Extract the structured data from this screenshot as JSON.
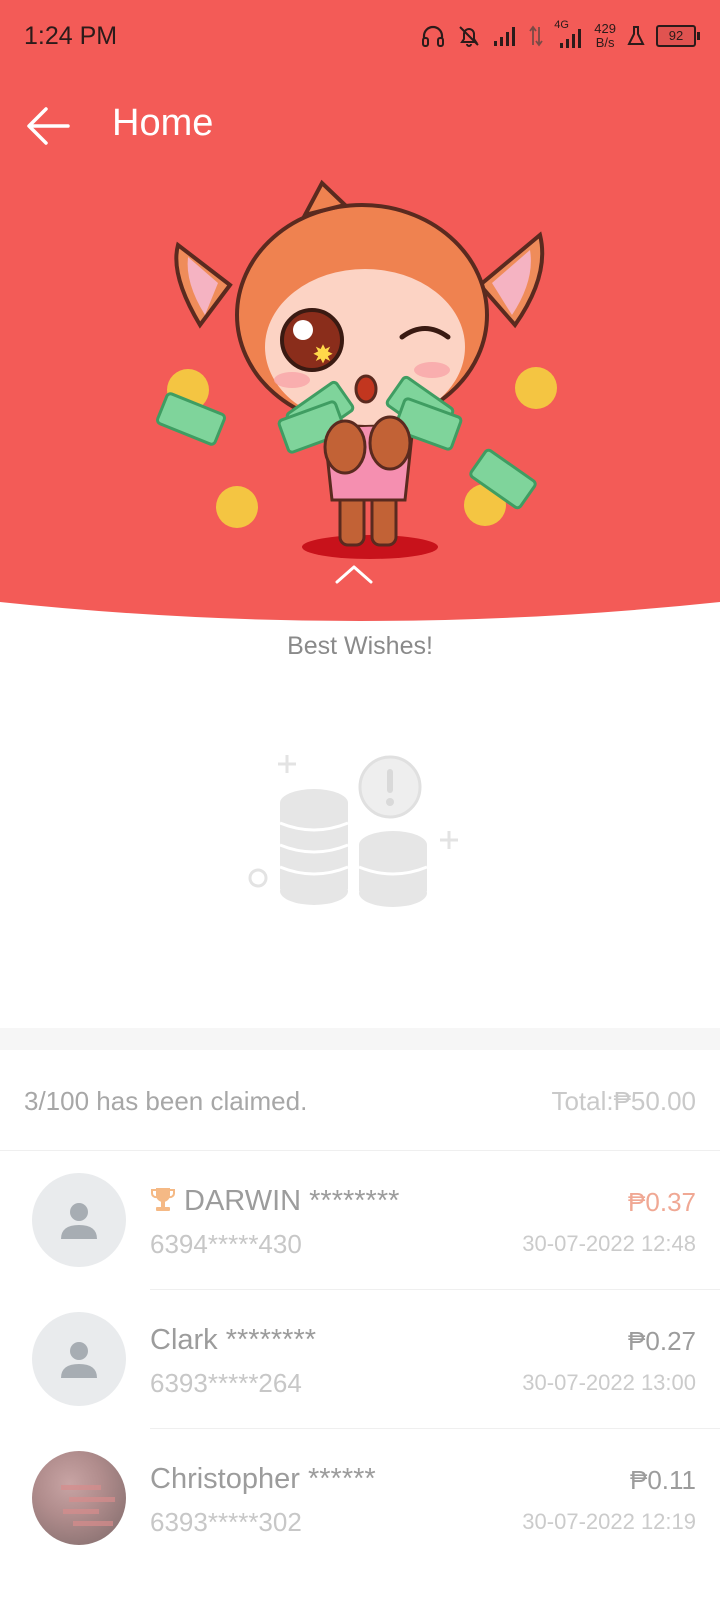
{
  "status_bar": {
    "time": "1:24 PM",
    "network_type": "4G",
    "speed_value": "429",
    "speed_unit": "B/s",
    "battery": "92",
    "icons": [
      "headset-icon",
      "bell-off-icon",
      "signal-icon",
      "data-arrows-icon",
      "signal-4g-icon",
      "speed-indicator",
      "flask-icon",
      "battery-icon"
    ]
  },
  "header": {
    "title": "Home",
    "background_color": "#f35b57"
  },
  "hero": {
    "message": "Best Wishes!"
  },
  "summary": {
    "claimed_text": "3/100 has been claimed.",
    "total_text": "Total:₱50.00"
  },
  "claims": [
    {
      "name": "DARWIN ********",
      "phone": "6394*****430",
      "amount": "₱0.37",
      "datetime": "30-07-2022 12:48",
      "best_luck": true,
      "avatar": "default-avatar-icon"
    },
    {
      "name": "Clark ********",
      "phone": "6393*****264",
      "amount": "₱0.27",
      "datetime": "30-07-2022 13:00",
      "best_luck": false,
      "avatar": "default-avatar-icon"
    },
    {
      "name": "Christopher ******",
      "phone": "6393*****302",
      "amount": "₱0.11",
      "datetime": "30-07-2022 12:19",
      "best_luck": false,
      "avatar": "photo"
    }
  ]
}
